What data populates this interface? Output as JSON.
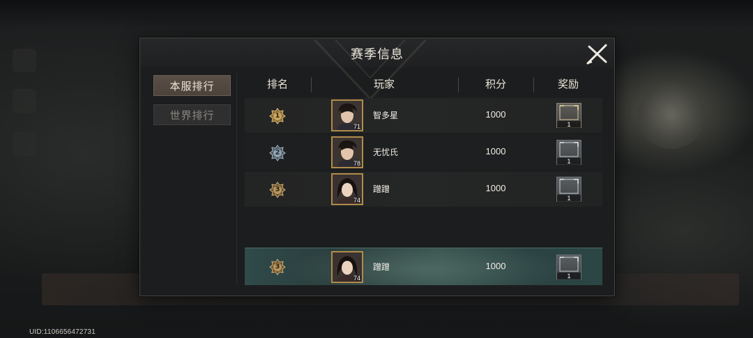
{
  "uid": "UID:1106656472731",
  "dialog": {
    "title": "赛季信息",
    "tabs": [
      {
        "label": "本服排行",
        "active": true
      },
      {
        "label": "世界排行",
        "active": false
      }
    ],
    "columns": {
      "rank": "排名",
      "player": "玩家",
      "score": "积分",
      "reward": "奖励"
    },
    "rows": [
      {
        "rank": "1",
        "rank_tier": "gold",
        "level": "71",
        "name": "智多星",
        "score": "1000",
        "reward_count": "1",
        "avatar": "male"
      },
      {
        "rank": "2",
        "rank_tier": "silver",
        "level": "78",
        "name": "无忧氏",
        "score": "1000",
        "reward_count": "1",
        "avatar": "male"
      },
      {
        "rank": "3",
        "rank_tier": "bronze",
        "level": "74",
        "name": "蹭蹭",
        "score": "1000",
        "reward_count": "1",
        "avatar": "female"
      }
    ],
    "self_row": {
      "rank": "3",
      "rank_tier": "bronze",
      "level": "74",
      "name": "蹭蹭",
      "score": "1000",
      "reward_count": "1",
      "avatar": "female"
    }
  },
  "colors": {
    "gold": "#c9a560",
    "silver": "#8fa2b0",
    "bronze": "#b79660",
    "highlight": "#2f4a49"
  }
}
